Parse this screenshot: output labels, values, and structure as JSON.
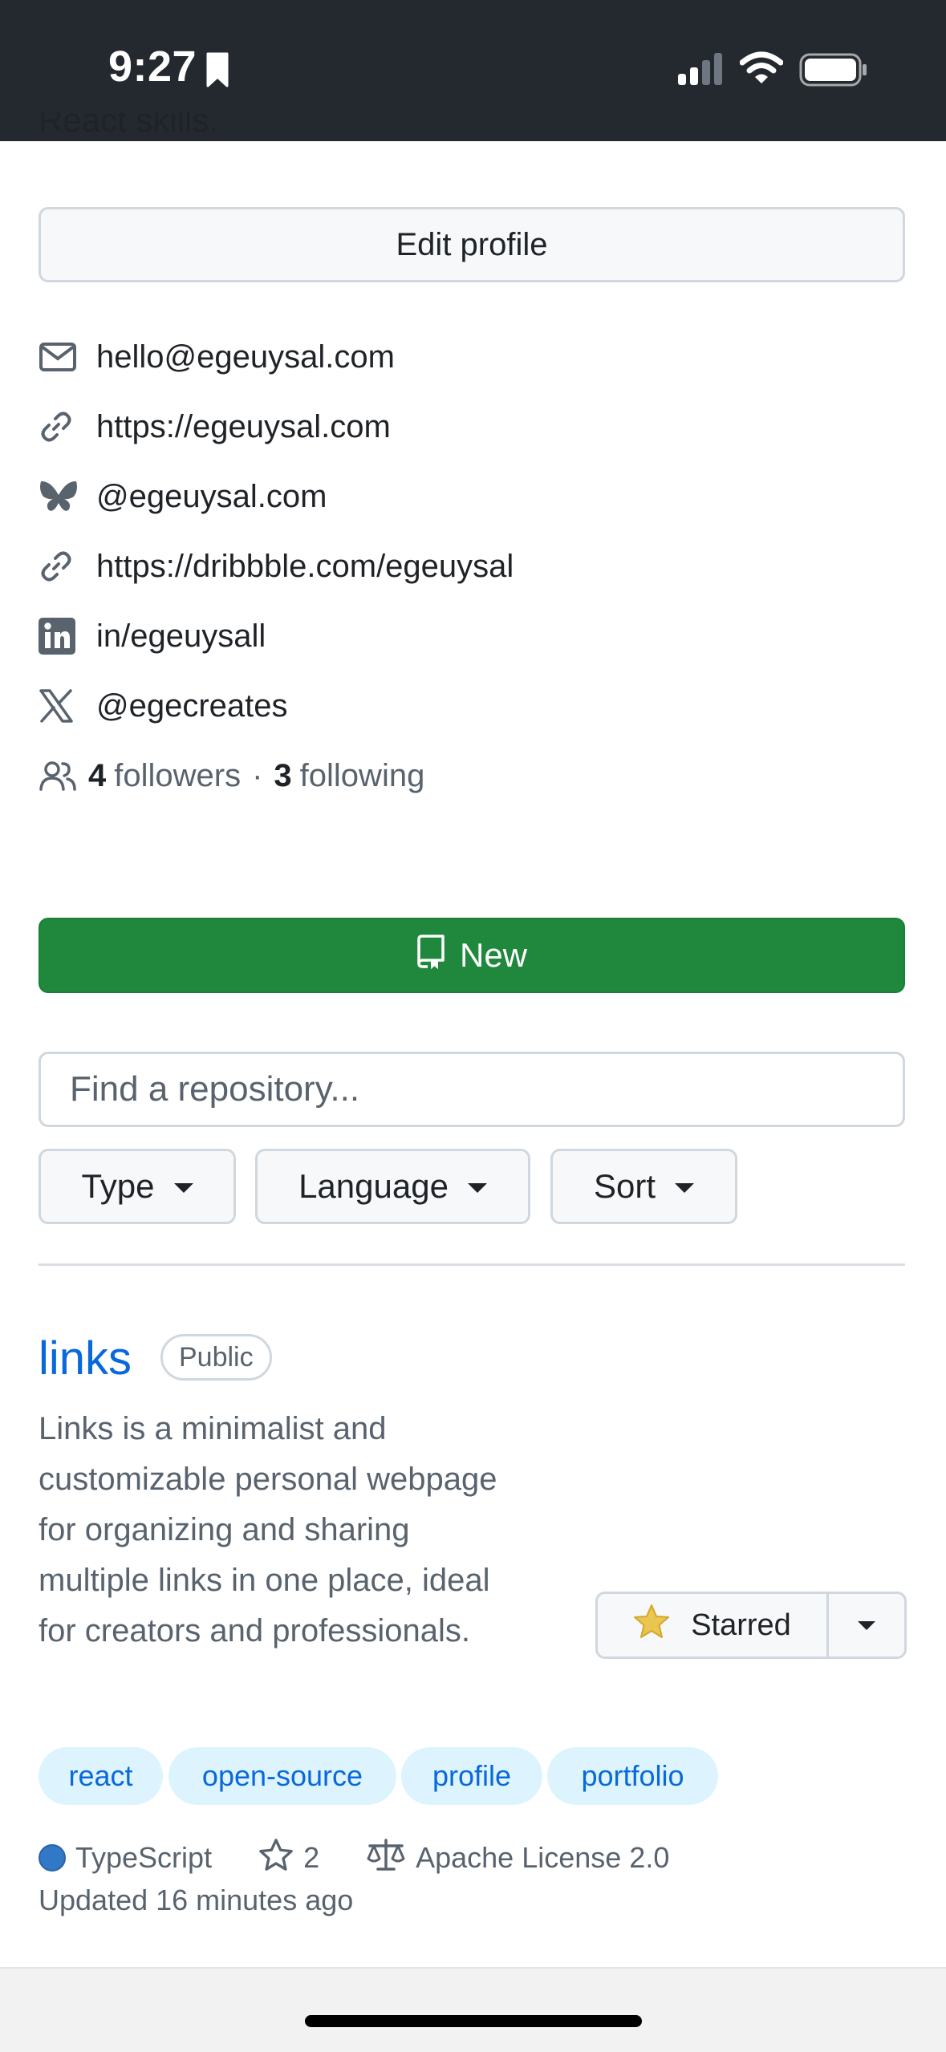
{
  "status_bar": {
    "time": "9:27"
  },
  "profile": {
    "bio_cutoff": "React skills.",
    "edit_profile_label": "Edit profile",
    "links": [
      {
        "icon": "mail-icon",
        "text": "hello@egeuysal.com"
      },
      {
        "icon": "link-icon",
        "text": "https://egeuysal.com"
      },
      {
        "icon": "bluesky-butterfly-icon",
        "text": "@egeuysal.com"
      },
      {
        "icon": "link-icon",
        "text": "https://dribbble.com/egeuysal"
      },
      {
        "icon": "linkedin-icon",
        "text": "in/egeuysall"
      },
      {
        "icon": "x-logo-icon",
        "text": "@egecreates"
      }
    ],
    "followers_count": "4",
    "followers_label": "followers",
    "separator": "·",
    "following_count": "3",
    "following_label": "following"
  },
  "repos_toolbar": {
    "new_label": "New",
    "search_placeholder": "Find a repository...",
    "filters": {
      "type": "Type",
      "language": "Language",
      "sort": "Sort"
    }
  },
  "repo": {
    "name": "links",
    "visibility": "Public",
    "description": "Links is a minimalist and customizable personal webpage for organizing and sharing multiple links in one place, ideal for creators and professionals.",
    "star_button_label": "Starred",
    "topics": [
      "react",
      "open-source",
      "profile",
      "portfolio"
    ],
    "language": "TypeScript",
    "language_color": "#3178c6",
    "stars": "2",
    "license": "Apache License 2.0",
    "updated": "Updated 16 minutes ago"
  },
  "colors": {
    "accent_blue": "#0969da",
    "primary_green": "#1f883d",
    "status_bar": "#24292f",
    "star_yellow": "#eac54f"
  }
}
